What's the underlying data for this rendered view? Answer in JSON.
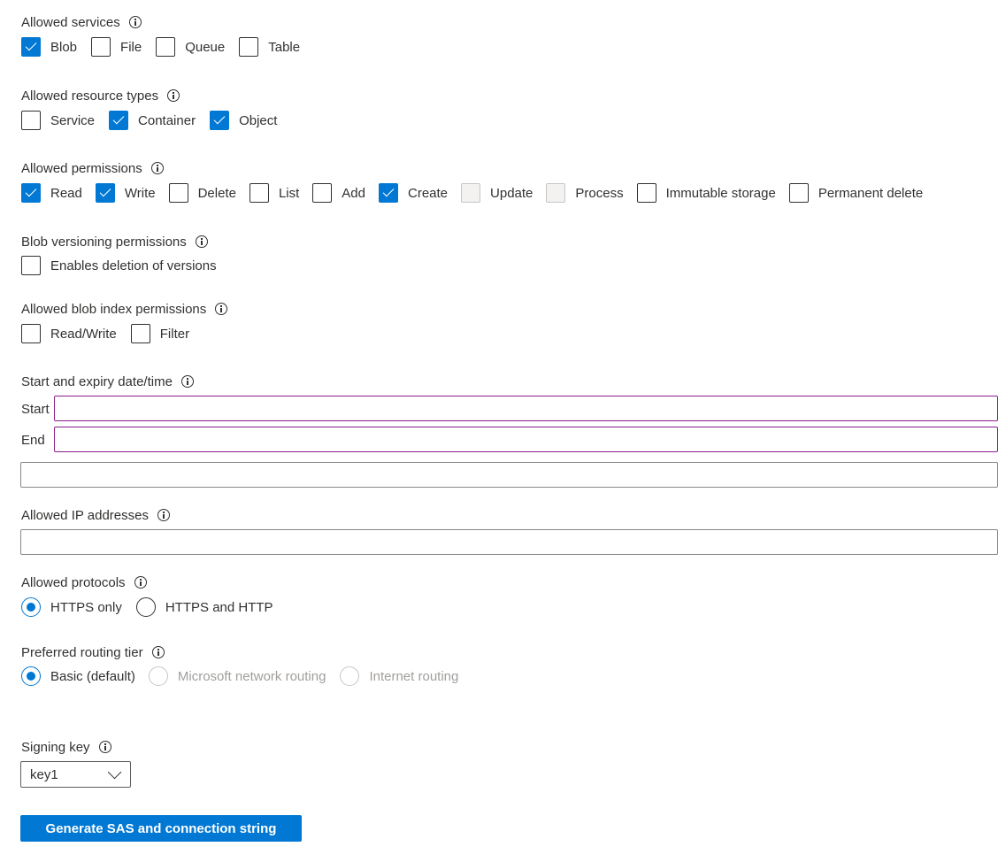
{
  "sections": {
    "services": {
      "label": "Allowed services",
      "options": [
        {
          "label": "Blob",
          "checked": true
        },
        {
          "label": "File",
          "checked": false
        },
        {
          "label": "Queue",
          "checked": false
        },
        {
          "label": "Table",
          "checked": false
        }
      ]
    },
    "resource_types": {
      "label": "Allowed resource types",
      "options": [
        {
          "label": "Service",
          "checked": false
        },
        {
          "label": "Container",
          "checked": true
        },
        {
          "label": "Object",
          "checked": true
        }
      ]
    },
    "permissions": {
      "label": "Allowed permissions",
      "options": [
        {
          "label": "Read",
          "checked": true
        },
        {
          "label": "Write",
          "checked": true
        },
        {
          "label": "Delete",
          "checked": false
        },
        {
          "label": "List",
          "checked": false
        },
        {
          "label": "Add",
          "checked": false
        },
        {
          "label": "Create",
          "checked": true
        },
        {
          "label": "Update",
          "checked": false,
          "disabled": true
        },
        {
          "label": "Process",
          "checked": false,
          "disabled": true
        },
        {
          "label": "Immutable storage",
          "checked": false
        },
        {
          "label": "Permanent delete",
          "checked": false
        }
      ]
    },
    "versioning": {
      "label": "Blob versioning permissions",
      "options": [
        {
          "label": "Enables deletion of versions",
          "checked": false
        }
      ]
    },
    "blob_index": {
      "label": "Allowed blob index permissions",
      "options": [
        {
          "label": "Read/Write",
          "checked": false
        },
        {
          "label": "Filter",
          "checked": false
        }
      ]
    },
    "datetime": {
      "label": "Start and expiry date/time",
      "start_label": "Start",
      "end_label": "End",
      "start_value": "",
      "end_value": "",
      "timezone_value": ""
    },
    "ip": {
      "label": "Allowed IP addresses",
      "value": ""
    },
    "protocols": {
      "label": "Allowed protocols",
      "options": [
        {
          "label": "HTTPS only",
          "selected": true
        },
        {
          "label": "HTTPS and HTTP",
          "selected": false
        }
      ]
    },
    "routing": {
      "label": "Preferred routing tier",
      "options": [
        {
          "label": "Basic (default)",
          "selected": true
        },
        {
          "label": "Microsoft network routing",
          "selected": false,
          "disabled": true
        },
        {
          "label": "Internet routing",
          "selected": false,
          "disabled": true
        }
      ]
    },
    "signing_key": {
      "label": "Signing key",
      "value": "key1"
    }
  },
  "generate_button": "Generate SAS and connection string",
  "colors": {
    "accent": "#0078d4",
    "focus_border": "#8a1e8c"
  }
}
